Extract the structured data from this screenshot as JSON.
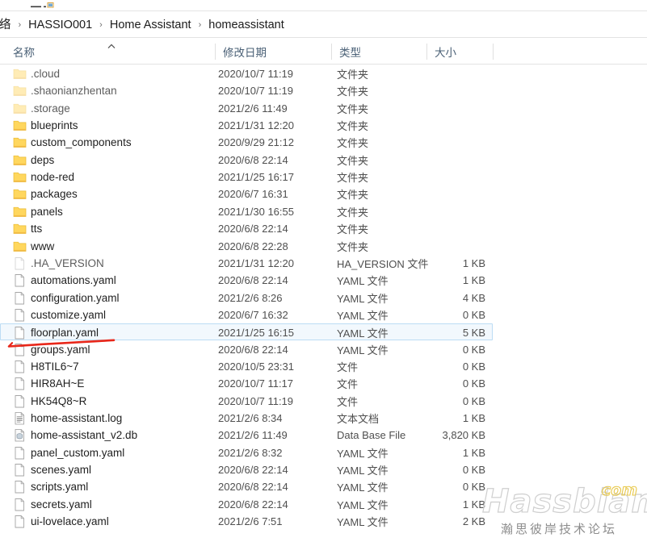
{
  "window": {
    "title_sliver": ""
  },
  "breadcrumb": {
    "separator": "›",
    "items": [
      {
        "label": "络",
        "clipped": true
      },
      {
        "label": "HASSIO001",
        "clipped": false
      },
      {
        "label": "Home Assistant",
        "clipped": false
      },
      {
        "label": "homeassistant",
        "clipped": false
      }
    ]
  },
  "columns": {
    "name": "名称",
    "date_modified": "修改日期",
    "type": "类型",
    "size": "大小",
    "sort_column": "名称",
    "sort_direction": "ascending"
  },
  "colors": {
    "folder": "#ffd75e",
    "folder_dim": "#fbeec2",
    "selection_bg": "#f2f8fd",
    "selection_border": "#bcdcf4",
    "annotation": "#e8271a",
    "watermark_accent": "#e8c84a",
    "header_text": "#4a6076"
  },
  "files": [
    {
      "name": ".cloud",
      "date": "2020/10/7 11:19",
      "type": "文件夹",
      "size": "",
      "icon": "folder-icon",
      "dim": true,
      "selected": false
    },
    {
      "name": ".shaonianzhentan",
      "date": "2020/10/7 11:19",
      "type": "文件夹",
      "size": "",
      "icon": "folder-icon",
      "dim": true,
      "selected": false
    },
    {
      "name": ".storage",
      "date": "2021/2/6 11:49",
      "type": "文件夹",
      "size": "",
      "icon": "folder-icon",
      "dim": true,
      "selected": false
    },
    {
      "name": "blueprints",
      "date": "2021/1/31 12:20",
      "type": "文件夹",
      "size": "",
      "icon": "folder-icon",
      "dim": false,
      "selected": false
    },
    {
      "name": "custom_components",
      "date": "2020/9/29 21:12",
      "type": "文件夹",
      "size": "",
      "icon": "folder-icon",
      "dim": false,
      "selected": false
    },
    {
      "name": "deps",
      "date": "2020/6/8 22:14",
      "type": "文件夹",
      "size": "",
      "icon": "folder-icon",
      "dim": false,
      "selected": false
    },
    {
      "name": "node-red",
      "date": "2021/1/25 16:17",
      "type": "文件夹",
      "size": "",
      "icon": "folder-icon",
      "dim": false,
      "selected": false
    },
    {
      "name": "packages",
      "date": "2020/6/7 16:31",
      "type": "文件夹",
      "size": "",
      "icon": "folder-icon",
      "dim": false,
      "selected": false
    },
    {
      "name": "panels",
      "date": "2021/1/30 16:55",
      "type": "文件夹",
      "size": "",
      "icon": "folder-icon",
      "dim": false,
      "selected": false
    },
    {
      "name": "tts",
      "date": "2020/6/8 22:14",
      "type": "文件夹",
      "size": "",
      "icon": "folder-icon",
      "dim": false,
      "selected": false
    },
    {
      "name": "www",
      "date": "2020/6/8 22:28",
      "type": "文件夹",
      "size": "",
      "icon": "folder-icon",
      "dim": false,
      "selected": false
    },
    {
      "name": ".HA_VERSION",
      "date": "2021/1/31 12:20",
      "type": "HA_VERSION 文件",
      "size": "1 KB",
      "icon": "file-icon",
      "dim": true,
      "selected": false
    },
    {
      "name": "automations.yaml",
      "date": "2020/6/8 22:14",
      "type": "YAML 文件",
      "size": "1 KB",
      "icon": "file-icon",
      "dim": false,
      "selected": false
    },
    {
      "name": "configuration.yaml",
      "date": "2021/2/6 8:26",
      "type": "YAML 文件",
      "size": "4 KB",
      "icon": "file-icon",
      "dim": false,
      "selected": false
    },
    {
      "name": "customize.yaml",
      "date": "2020/6/7 16:32",
      "type": "YAML 文件",
      "size": "0 KB",
      "icon": "file-icon",
      "dim": false,
      "selected": false
    },
    {
      "name": "floorplan.yaml",
      "date": "2021/1/25 16:15",
      "type": "YAML 文件",
      "size": "5 KB",
      "icon": "file-icon",
      "dim": false,
      "selected": true
    },
    {
      "name": "groups.yaml",
      "date": "2020/6/8 22:14",
      "type": "YAML 文件",
      "size": "0 KB",
      "icon": "file-icon",
      "dim": false,
      "selected": false
    },
    {
      "name": "H8TIL6~7",
      "date": "2020/10/5 23:31",
      "type": "文件",
      "size": "0 KB",
      "icon": "file-icon",
      "dim": false,
      "selected": false
    },
    {
      "name": "HIR8AH~E",
      "date": "2020/10/7 11:17",
      "type": "文件",
      "size": "0 KB",
      "icon": "file-icon",
      "dim": false,
      "selected": false
    },
    {
      "name": "HK54Q8~R",
      "date": "2020/10/7 11:19",
      "type": "文件",
      "size": "0 KB",
      "icon": "file-icon",
      "dim": false,
      "selected": false
    },
    {
      "name": "home-assistant.log",
      "date": "2021/2/6 8:34",
      "type": "文本文档",
      "size": "1 KB",
      "icon": "text-file-icon",
      "dim": false,
      "selected": false
    },
    {
      "name": "home-assistant_v2.db",
      "date": "2021/2/6 11:49",
      "type": "Data Base File",
      "size": "3,820 KB",
      "icon": "database-file-icon",
      "dim": false,
      "selected": false
    },
    {
      "name": "panel_custom.yaml",
      "date": "2021/2/6 8:32",
      "type": "YAML 文件",
      "size": "1 KB",
      "icon": "file-icon",
      "dim": false,
      "selected": false
    },
    {
      "name": "scenes.yaml",
      "date": "2020/6/8 22:14",
      "type": "YAML 文件",
      "size": "0 KB",
      "icon": "file-icon",
      "dim": false,
      "selected": false
    },
    {
      "name": "scripts.yaml",
      "date": "2020/6/8 22:14",
      "type": "YAML 文件",
      "size": "0 KB",
      "icon": "file-icon",
      "dim": false,
      "selected": false
    },
    {
      "name": "secrets.yaml",
      "date": "2020/6/8 22:14",
      "type": "YAML 文件",
      "size": "1 KB",
      "icon": "file-icon",
      "dim": false,
      "selected": false
    },
    {
      "name": "ui-lovelace.yaml",
      "date": "2021/2/6 7:51",
      "type": "YAML 文件",
      "size": "2 KB",
      "icon": "file-icon",
      "dim": false,
      "selected": false
    }
  ],
  "annotation": {
    "shape": "hand-drawn-underline",
    "target": "floorplan.yaml"
  },
  "watermark": {
    "brand": "Hassbian",
    "tld": "com",
    "subtitle": "瀚思彼岸技术论坛"
  }
}
